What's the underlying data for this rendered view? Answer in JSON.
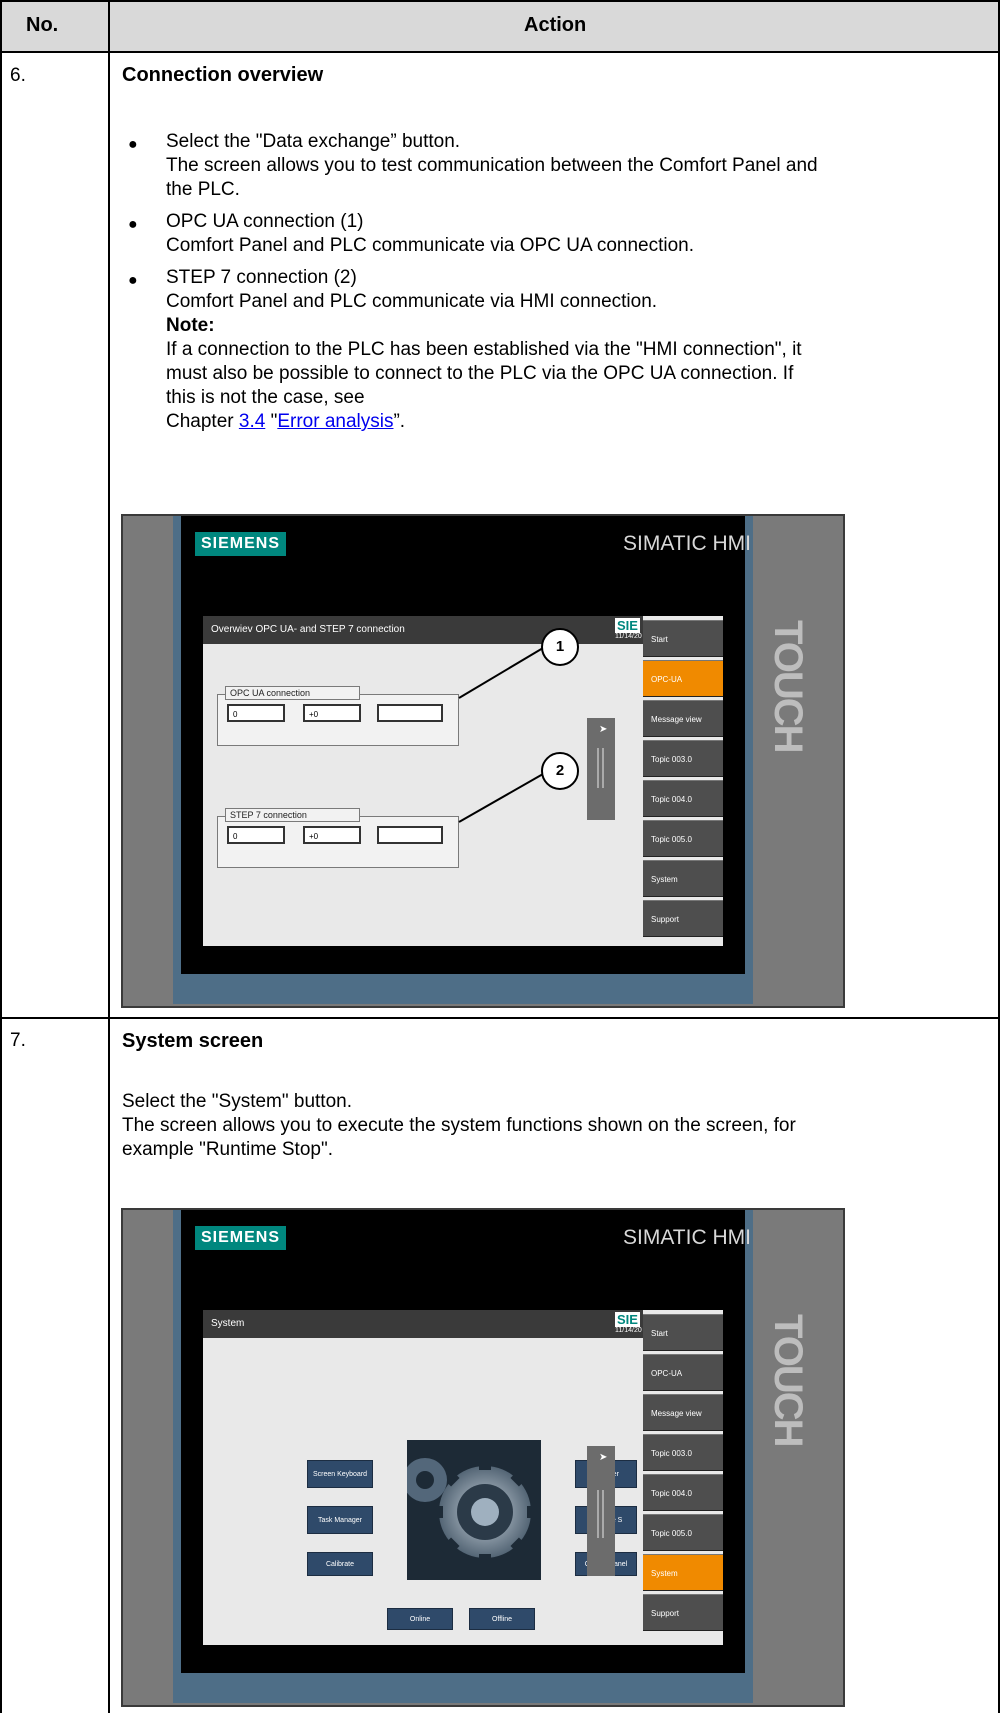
{
  "table": {
    "col_no_header": "No.",
    "col_action_header": "Action"
  },
  "step6": {
    "number": "6.",
    "title": "Connection overview",
    "bullet1_line1": "Select the \"Data exchange” button.",
    "bullet1_line2": "The screen allows you to test communication between the Comfort Panel and",
    "bullet1_line3": "the PLC.",
    "bullet2_line1": "OPC UA connection (1)",
    "bullet2_line2": "Comfort Panel and PLC communicate via OPC UA connection.",
    "bullet3_line1": "STEP 7 connection (2)",
    "bullet3_line2": "Comfort Panel and PLC communicate via HMI connection.",
    "note_label": "Note:",
    "note_line1": "If a connection to the PLC has been established via the \"HMI connection\", it",
    "note_line2": "must also be possible to connect to the PLC via the OPC UA connection. If",
    "note_line3": "this is not the case, see",
    "chapter_prefix": "Chapter ",
    "chapter_number": "3.4",
    "chapter_quote_open": " \"",
    "chapter_link": "Error analysis",
    "chapter_quote_close": "”."
  },
  "step7": {
    "number": "7.",
    "title": "System screen",
    "line1": "Select the \"System\" button.",
    "line2": "The screen allows you to execute the system functions shown on the screen, for",
    "line3": "example \"Runtime Stop\"."
  },
  "hmi": {
    "brand": "SIEMENS",
    "product": "SIMATIC HMI",
    "touch": "TOUCH",
    "mini_logo": "SIE",
    "mini_date": "11/14/20",
    "nav_items": [
      "Start",
      "OPC-UA",
      "Message view",
      "Topic 003.0",
      "Topic 004.0",
      "Topic 005.0",
      "System",
      "Support"
    ],
    "colors": {
      "active": "#f08a00",
      "brand": "#00877e",
      "bezel_accent": "#4e6e87"
    }
  },
  "screen1": {
    "title": "Overwiev OPC UA- and STEP 7 connection",
    "active_nav": "OPC-UA",
    "opc_group": "OPC UA connection",
    "opc_field1": "0",
    "opc_field2": "+0",
    "step7_group": "STEP 7 connection",
    "step7_field1": "0",
    "step7_field2": "+0",
    "callout1": "1",
    "callout2": "2"
  },
  "screen2": {
    "title": "System",
    "active_nav": "System",
    "btn_screen_keyboard": "Screen Keyboard",
    "btn_task_manager": "Task Manager",
    "btn_calibrate": "Calibrate",
    "btn_transfer": "Transfer",
    "btn_runtime_stop": "Runtime S",
    "btn_control_panel": "Control Panel",
    "btn_online": "Online",
    "btn_offline": "Offline"
  }
}
